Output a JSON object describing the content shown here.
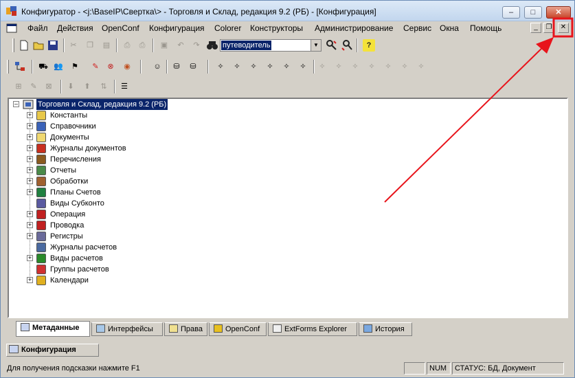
{
  "window": {
    "title": "Конфигуратор - <j:\\BaseIP\\Свертка\\> - Торговля и Склад, редакция 9.2 (РБ) - [Конфигурация]",
    "minimize_glyph": "–",
    "maximize_glyph": "□",
    "close_glyph": "✕"
  },
  "menu": [
    "Файл",
    "Действия",
    "OpenConf",
    "Конфигурация",
    "Colorer",
    "Конструкторы",
    "Администрирование",
    "Сервис",
    "Окна",
    "Помощь"
  ],
  "mdi": {
    "minimize_glyph": "_",
    "restore_glyph": "❐",
    "close_glyph": "✕"
  },
  "toolbar": {
    "search_combo_value": "путеводитель",
    "help_glyph": "?"
  },
  "tree": {
    "root": "Торговля и Склад, редакция 9.2 (РБ)",
    "items": [
      {
        "label": "Константы",
        "expandable": true,
        "icon": "constants-icon"
      },
      {
        "label": "Справочники",
        "expandable": true,
        "icon": "catalogs-icon"
      },
      {
        "label": "Документы",
        "expandable": true,
        "icon": "folder-icon"
      },
      {
        "label": "Журналы документов",
        "expandable": true,
        "icon": "journals-icon"
      },
      {
        "label": "Перечисления",
        "expandable": true,
        "icon": "enums-icon"
      },
      {
        "label": "Отчеты",
        "expandable": true,
        "icon": "reports-icon"
      },
      {
        "label": "Обработки",
        "expandable": true,
        "icon": "processing-icon"
      },
      {
        "label": "Планы Счетов",
        "expandable": true,
        "icon": "chart-of-accounts-icon"
      },
      {
        "label": "Виды Субконто",
        "expandable": false,
        "icon": "subconto-icon"
      },
      {
        "label": "Операция",
        "expandable": true,
        "icon": "operation-icon"
      },
      {
        "label": "Проводка",
        "expandable": true,
        "icon": "posting-icon"
      },
      {
        "label": "Регистры",
        "expandable": true,
        "icon": "registers-icon"
      },
      {
        "label": "Журналы расчетов",
        "expandable": false,
        "icon": "calc-journals-icon"
      },
      {
        "label": "Виды расчетов",
        "expandable": true,
        "icon": "calc-types-icon"
      },
      {
        "label": "Группы расчетов",
        "expandable": false,
        "icon": "calc-groups-icon"
      },
      {
        "label": "Календари",
        "expandable": true,
        "icon": "calendars-icon"
      }
    ]
  },
  "tabs": [
    "Метаданные",
    "Интерфейсы",
    "Права",
    "OpenConf",
    "ExtForms Explorer",
    "История"
  ],
  "docbar": {
    "label": "Конфигурация"
  },
  "status": {
    "hint": "Для получения подсказки нажмите F1",
    "num": "NUM",
    "state": "СТАТУС: БД, Документ"
  },
  "colors": {
    "annotation": "#e8141b",
    "selection": "#0a246a",
    "face": "#d4d0c8"
  }
}
